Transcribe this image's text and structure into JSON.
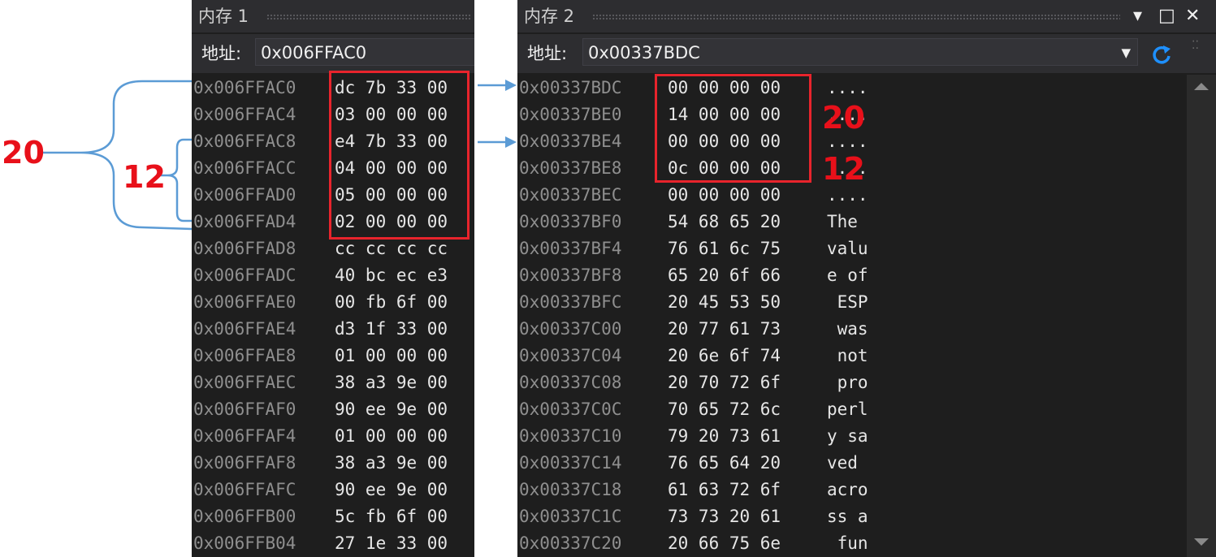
{
  "memory1": {
    "title": "内存 1",
    "address_label": "地址:",
    "address_value": "0x006FFAC0",
    "rows": [
      {
        "addr": "0x006FFAC0",
        "bytes": "dc 7b 33 00"
      },
      {
        "addr": "0x006FFAC4",
        "bytes": "03 00 00 00"
      },
      {
        "addr": "0x006FFAC8",
        "bytes": "e4 7b 33 00"
      },
      {
        "addr": "0x006FFACC",
        "bytes": "04 00 00 00"
      },
      {
        "addr": "0x006FFAD0",
        "bytes": "05 00 00 00"
      },
      {
        "addr": "0x006FFAD4",
        "bytes": "02 00 00 00"
      },
      {
        "addr": "0x006FFAD8",
        "bytes": "cc cc cc cc"
      },
      {
        "addr": "0x006FFADC",
        "bytes": "40 bc ec e3"
      },
      {
        "addr": "0x006FFAE0",
        "bytes": "00 fb 6f 00"
      },
      {
        "addr": "0x006FFAE4",
        "bytes": "d3 1f 33 00"
      },
      {
        "addr": "0x006FFAE8",
        "bytes": "01 00 00 00"
      },
      {
        "addr": "0x006FFAEC",
        "bytes": "38 a3 9e 00"
      },
      {
        "addr": "0x006FFAF0",
        "bytes": "90 ee 9e 00"
      },
      {
        "addr": "0x006FFAF4",
        "bytes": "01 00 00 00"
      },
      {
        "addr": "0x006FFAF8",
        "bytes": "38 a3 9e 00"
      },
      {
        "addr": "0x006FFAFC",
        "bytes": "90 ee 9e 00"
      },
      {
        "addr": "0x006FFB00",
        "bytes": "5c fb 6f 00"
      },
      {
        "addr": "0x006FFB04",
        "bytes": "27 1e 33 00"
      }
    ]
  },
  "memory2": {
    "title": "内存 2",
    "address_label": "地址:",
    "address_value": "0x00337BDC",
    "window_controls": {
      "dropdown": "▾",
      "maximize": "□",
      "close": "✕"
    },
    "rows": [
      {
        "addr": "0x00337BDC",
        "bytes": "00 00 00 00",
        "ascii": "...."
      },
      {
        "addr": "0x00337BE0",
        "bytes": "14 00 00 00",
        "ascii": "...."
      },
      {
        "addr": "0x00337BE4",
        "bytes": "00 00 00 00",
        "ascii": "...."
      },
      {
        "addr": "0x00337BE8",
        "bytes": "0c 00 00 00",
        "ascii": "...."
      },
      {
        "addr": "0x00337BEC",
        "bytes": "00 00 00 00",
        "ascii": "...."
      },
      {
        "addr": "0x00337BF0",
        "bytes": "54 68 65 20",
        "ascii": "The "
      },
      {
        "addr": "0x00337BF4",
        "bytes": "76 61 6c 75",
        "ascii": "valu"
      },
      {
        "addr": "0x00337BF8",
        "bytes": "65 20 6f 66",
        "ascii": "e of"
      },
      {
        "addr": "0x00337BFC",
        "bytes": "20 45 53 50",
        "ascii": " ESP"
      },
      {
        "addr": "0x00337C00",
        "bytes": "20 77 61 73",
        "ascii": " was"
      },
      {
        "addr": "0x00337C04",
        "bytes": "20 6e 6f 74",
        "ascii": " not"
      },
      {
        "addr": "0x00337C08",
        "bytes": "20 70 72 6f",
        "ascii": " pro"
      },
      {
        "addr": "0x00337C0C",
        "bytes": "70 65 72 6c",
        "ascii": "perl"
      },
      {
        "addr": "0x00337C10",
        "bytes": "79 20 73 61",
        "ascii": "y sa"
      },
      {
        "addr": "0x00337C14",
        "bytes": "76 65 64 20",
        "ascii": "ved "
      },
      {
        "addr": "0x00337C18",
        "bytes": "61 63 72 6f",
        "ascii": "acro"
      },
      {
        "addr": "0x00337C1C",
        "bytes": "73 73 20 61",
        "ascii": "ss a"
      },
      {
        "addr": "0x00337C20",
        "bytes": "20 66 75 6e",
        "ascii": " fun"
      }
    ]
  },
  "annotations": {
    "left_outer": "20",
    "left_inner": "12",
    "right_top": "20",
    "right_bottom": "12",
    "accent_red": "#e8242c",
    "arrow_blue": "#5b9bd5"
  }
}
